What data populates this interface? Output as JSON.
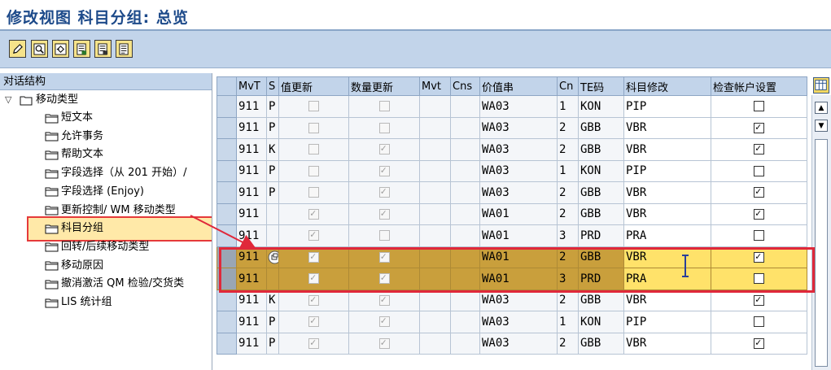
{
  "window": {
    "title": "修改视图 科目分组: 总览"
  },
  "toolbar": {
    "buttons": [
      {
        "icon": "edit-pencil-icon"
      },
      {
        "icon": "search-icon"
      },
      {
        "icon": "undo-icon"
      },
      {
        "icon": "copy-entry-icon"
      },
      {
        "icon": "delete-entry-icon"
      },
      {
        "icon": "select-all-icon"
      }
    ]
  },
  "nav": {
    "header": "对话结构",
    "root": {
      "toggle": "▽",
      "label": "移动类型"
    },
    "items": [
      {
        "label": "短文本"
      },
      {
        "label": "允许事务"
      },
      {
        "label": "帮助文本"
      },
      {
        "label": "字段选择（从 201 开始）/"
      },
      {
        "label": "字段选择 (Enjoy)"
      },
      {
        "label": "更新控制/ WM 移动类型"
      },
      {
        "label": "科目分组",
        "selected": true
      },
      {
        "label": "回转/后续移动类型"
      },
      {
        "label": "移动原因"
      },
      {
        "label": "撤消激活 QM 检验/交货类"
      },
      {
        "label": "LIS 统计组"
      }
    ]
  },
  "table": {
    "columns": [
      "MvT",
      "S",
      "值更新",
      "数量更新",
      "Mvt",
      "Cns",
      "价值串",
      "Cn",
      "TE码",
      "科目修改",
      "检查帐户设置"
    ],
    "rows": [
      {
        "mvt": "911",
        "s": "P",
        "val": false,
        "qty": false,
        "mvt2": "",
        "cns": "",
        "chain": "WA03",
        "cn": "1",
        "te": "KON",
        "acc": "PIP",
        "chk": false,
        "hl": false
      },
      {
        "mvt": "911",
        "s": "P",
        "val": false,
        "qty": false,
        "mvt2": "",
        "cns": "",
        "chain": "WA03",
        "cn": "2",
        "te": "GBB",
        "acc": "VBR",
        "chk": true,
        "hl": false
      },
      {
        "mvt": "911",
        "s": "K",
        "val": false,
        "qty": true,
        "mvt2": "",
        "cns": "",
        "chain": "WA03",
        "cn": "2",
        "te": "GBB",
        "acc": "VBR",
        "chk": true,
        "hl": false
      },
      {
        "mvt": "911",
        "s": "P",
        "val": false,
        "qty": true,
        "mvt2": "",
        "cns": "",
        "chain": "WA03",
        "cn": "1",
        "te": "KON",
        "acc": "PIP",
        "chk": false,
        "hl": false
      },
      {
        "mvt": "911",
        "s": "P",
        "val": false,
        "qty": true,
        "mvt2": "",
        "cns": "",
        "chain": "WA03",
        "cn": "2",
        "te": "GBB",
        "acc": "VBR",
        "chk": true,
        "hl": false
      },
      {
        "mvt": "911",
        "s": "",
        "val": true,
        "qty": true,
        "mvt2": "",
        "cns": "",
        "chain": "WA01",
        "cn": "2",
        "te": "GBB",
        "acc": "VBR",
        "chk": true,
        "hl": false
      },
      {
        "mvt": "911",
        "s": "",
        "val": true,
        "qty": false,
        "mvt2": "",
        "cns": "",
        "chain": "WA01",
        "cn": "3",
        "te": "PRD",
        "acc": "PRA",
        "chk": false,
        "hl": false
      },
      {
        "mvt": "911",
        "s": "",
        "val": true,
        "qty": true,
        "mvt2": "",
        "cns": "",
        "chain": "WA01",
        "cn": "2",
        "te": "GBB",
        "acc": "VBR",
        "chk": true,
        "hl": true,
        "popup": true
      },
      {
        "mvt": "911",
        "s": "",
        "val": true,
        "qty": true,
        "mvt2": "",
        "cns": "",
        "chain": "WA01",
        "cn": "3",
        "te": "PRD",
        "acc": "PRA",
        "chk": false,
        "hl": true
      },
      {
        "mvt": "911",
        "s": "K",
        "val": true,
        "qty": true,
        "mvt2": "",
        "cns": "",
        "chain": "WA03",
        "cn": "2",
        "te": "GBB",
        "acc": "VBR",
        "chk": true,
        "hl": false
      },
      {
        "mvt": "911",
        "s": "P",
        "val": true,
        "qty": true,
        "mvt2": "",
        "cns": "",
        "chain": "WA03",
        "cn": "1",
        "te": "KON",
        "acc": "PIP",
        "chk": false,
        "hl": false
      },
      {
        "mvt": "911",
        "s": "P",
        "val": true,
        "qty": true,
        "mvt2": "",
        "cns": "",
        "chain": "WA03",
        "cn": "2",
        "te": "GBB",
        "acc": "VBR",
        "chk": true,
        "hl": false
      }
    ]
  },
  "scrollbar": {
    "up_icon": "scroll-up-arrow-icon",
    "down_icon": "scroll-down-arrow-icon"
  },
  "column_settings_icon": "table-settings-icon",
  "colors": {
    "highlight_row": "#c99f3c",
    "highlight_border": "#e0283a",
    "header_bg": "#c2d4ea",
    "title": "#1d4a8a"
  }
}
